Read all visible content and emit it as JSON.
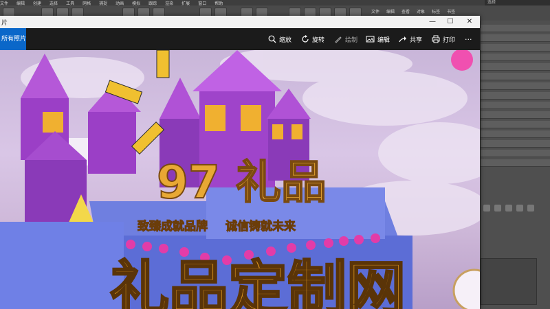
{
  "app": {
    "menu": [
      "文件",
      "编辑",
      "创建",
      "选择",
      "工具",
      "网格",
      "捕捉",
      "动画",
      "模拟",
      "跟踪",
      "渲染",
      "扩展",
      "窗口",
      "帮助"
    ],
    "menu_right": [
      "文件",
      "编辑",
      "查看",
      "对象",
      "标签",
      "书签"
    ],
    "search_placeholder": "选择"
  },
  "viewer": {
    "title": "片",
    "back_tab_label": "所有照片",
    "commands": [
      {
        "label": "缩放",
        "icon": "zoom-icon"
      },
      {
        "label": "旋转",
        "icon": "rotate-icon"
      },
      {
        "label": "绘制",
        "icon": "draw-icon"
      },
      {
        "label": "编辑",
        "icon": "edit-icon"
      },
      {
        "label": "共享",
        "icon": "share-icon"
      },
      {
        "label": "打印",
        "icon": "print-icon"
      }
    ],
    "more_label": "···",
    "window_controls": {
      "minimize": "—",
      "maximize": "☐",
      "close": "✕"
    }
  },
  "poster": {
    "headline": "97 礼品",
    "slogan_left": "致臻成就品牌",
    "slogan_right": "诚信铸就未来",
    "bottom_title": "礼品定制网",
    "colors": {
      "castle": "#9b3fc6",
      "base": "#6f7fe0",
      "gold": "#e8a834",
      "sky": "#d3c0e2",
      "pink": "#e23ca8"
    }
  }
}
